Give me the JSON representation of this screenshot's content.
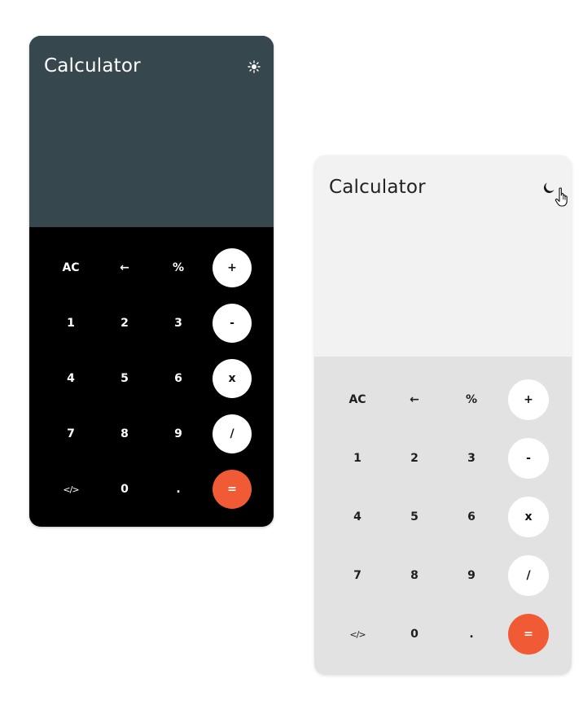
{
  "colors": {
    "accent": "#f05a35",
    "dark_display_bg": "#37474e",
    "dark_keypad_bg": "#000000",
    "light_display_bg": "#f2f2f2",
    "light_keypad_bg": "#e2e2e2"
  },
  "dark_calculator": {
    "title": "Calculator",
    "theme_icon": "sun-icon",
    "keys": {
      "ac": "AC",
      "back": "←",
      "percent": "%",
      "plus": "+",
      "one": "1",
      "two": "2",
      "three": "3",
      "minus": "-",
      "four": "4",
      "five": "5",
      "six": "6",
      "multiply": "x",
      "seven": "7",
      "eight": "8",
      "nine": "9",
      "divide": "/",
      "code": "</>",
      "zero": "0",
      "dot": ".",
      "equals": "="
    }
  },
  "light_calculator": {
    "title": "Calculator",
    "theme_icon": "moon-icon",
    "keys": {
      "ac": "AC",
      "back": "←",
      "percent": "%",
      "plus": "+",
      "one": "1",
      "two": "2",
      "three": "3",
      "minus": "-",
      "four": "4",
      "five": "5",
      "six": "6",
      "multiply": "x",
      "seven": "7",
      "eight": "8",
      "nine": "9",
      "divide": "/",
      "code": "</>",
      "zero": "0",
      "dot": ".",
      "equals": "="
    }
  }
}
